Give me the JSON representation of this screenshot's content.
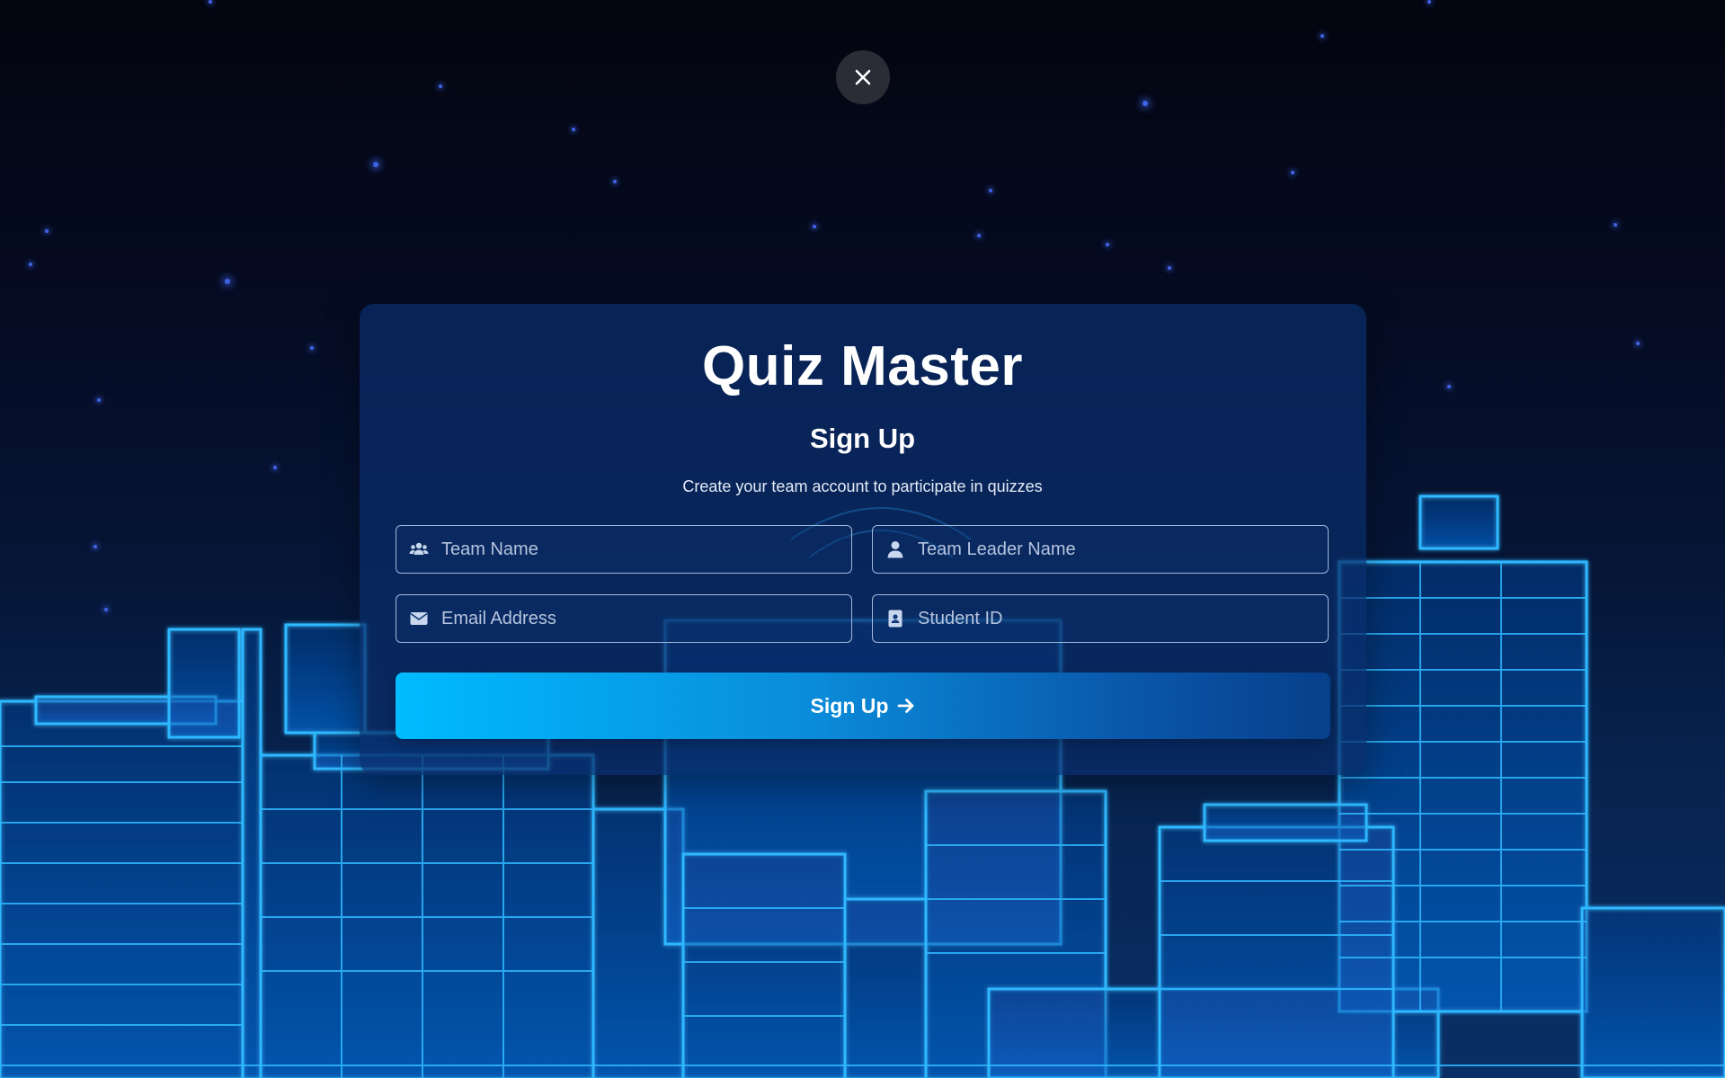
{
  "app": {
    "title": "Quiz Master",
    "subtitle": "Sign Up",
    "description": "Create your team account to participate in quizzes"
  },
  "form": {
    "team_name": {
      "placeholder": "Team Name",
      "value": "",
      "icon": "users-icon"
    },
    "team_leader_name": {
      "placeholder": "Team Leader Name",
      "value": "",
      "icon": "user-icon"
    },
    "email": {
      "placeholder": "Email Address",
      "value": "",
      "icon": "envelope-icon"
    },
    "student_id": {
      "placeholder": "Student ID",
      "value": "",
      "icon": "id-card-icon"
    },
    "submit_label": "Sign Up",
    "submit_icon": "arrow-right-icon"
  },
  "close": {
    "icon": "close-icon"
  },
  "colors": {
    "background_top": "#03050f",
    "wireframe": "#29b6ff",
    "card": "#0a2d69",
    "button_start": "#00bbff",
    "button_end": "#073f8a",
    "placeholder": "#b6c4de"
  }
}
